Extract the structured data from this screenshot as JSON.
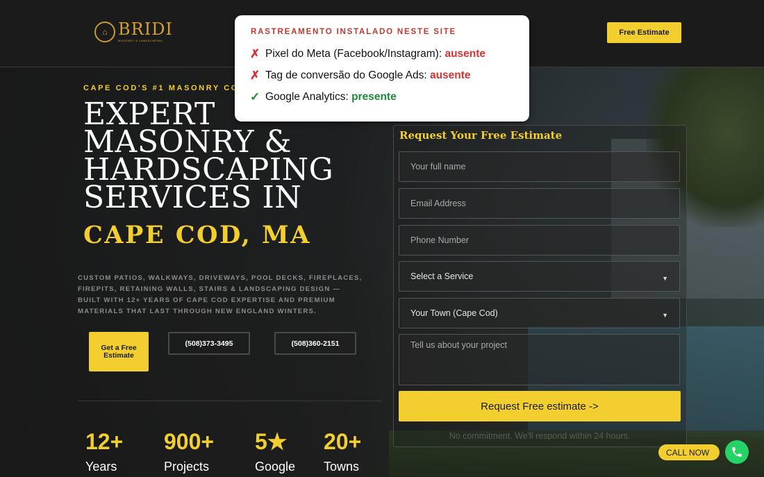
{
  "header": {
    "logo_text": "BRIDI",
    "logo_sub": "MASONRY & LANDSCAPING",
    "cta_label": "Free Estimate"
  },
  "overlay": {
    "title": "RASTREAMENTO INSTALADO NESTE SITE",
    "items": [
      {
        "mark": "✗",
        "label": "Pixel do Meta (Facebook/Instagram): ",
        "status": "ausente"
      },
      {
        "mark": "✗",
        "label": "Tag de conversão do Google Ads: ",
        "status": "ausente"
      },
      {
        "mark": "✓",
        "label": "Google Analytics: ",
        "status": "presente"
      }
    ]
  },
  "hero": {
    "eyebrow": "CAPE COD'S #1 MASONRY CONT",
    "title_lines": [
      "EXPERT",
      "MASONRY &",
      "HARDSCAPING",
      "SERVICES IN"
    ],
    "title_accent": "CAPE COD, MA",
    "lead": "CUSTOM PATIOS, WALKWAYS, DRIVEWAYS, POOL DECKS, FIREPLACES, FIREPITS, RETAINING WALLS, STAIRS & LANDSCAPING DESIGN — BUILT WITH 12+ YEARS OF CAPE COD EXPERTISE AND PREMIUM MATERIALS THAT LAST THROUGH NEW ENGLAND WINTERS.",
    "cta_label": "Get a Free Estimate",
    "phone1": "(508)373-3495",
    "phone2": "(508)360-2151"
  },
  "stats": [
    {
      "num": "12+",
      "label": "Years"
    },
    {
      "num": "900+",
      "label": "Projects"
    },
    {
      "num": "5★",
      "label": "Google"
    },
    {
      "num": "20+",
      "label": "Towns"
    }
  ],
  "form": {
    "title": "Request Your Free Estimate",
    "name_placeholder": "Your full name",
    "email_placeholder": "Email Address",
    "phone_placeholder": "Phone Number",
    "service_value": "Select a Service",
    "town_value": "Your Town (Cape Cod)",
    "message_placeholder": "Tell us about your project",
    "submit_label": "Request Free estimate ->",
    "note": "No commitment. We'll respond within 24 hours."
  },
  "floating": {
    "call_label": "CALL NOW"
  },
  "colors": {
    "accent": "#f2cf2e",
    "background": "#1b1b1b",
    "bad": "#d63333",
    "good": "#1e8a3c"
  }
}
